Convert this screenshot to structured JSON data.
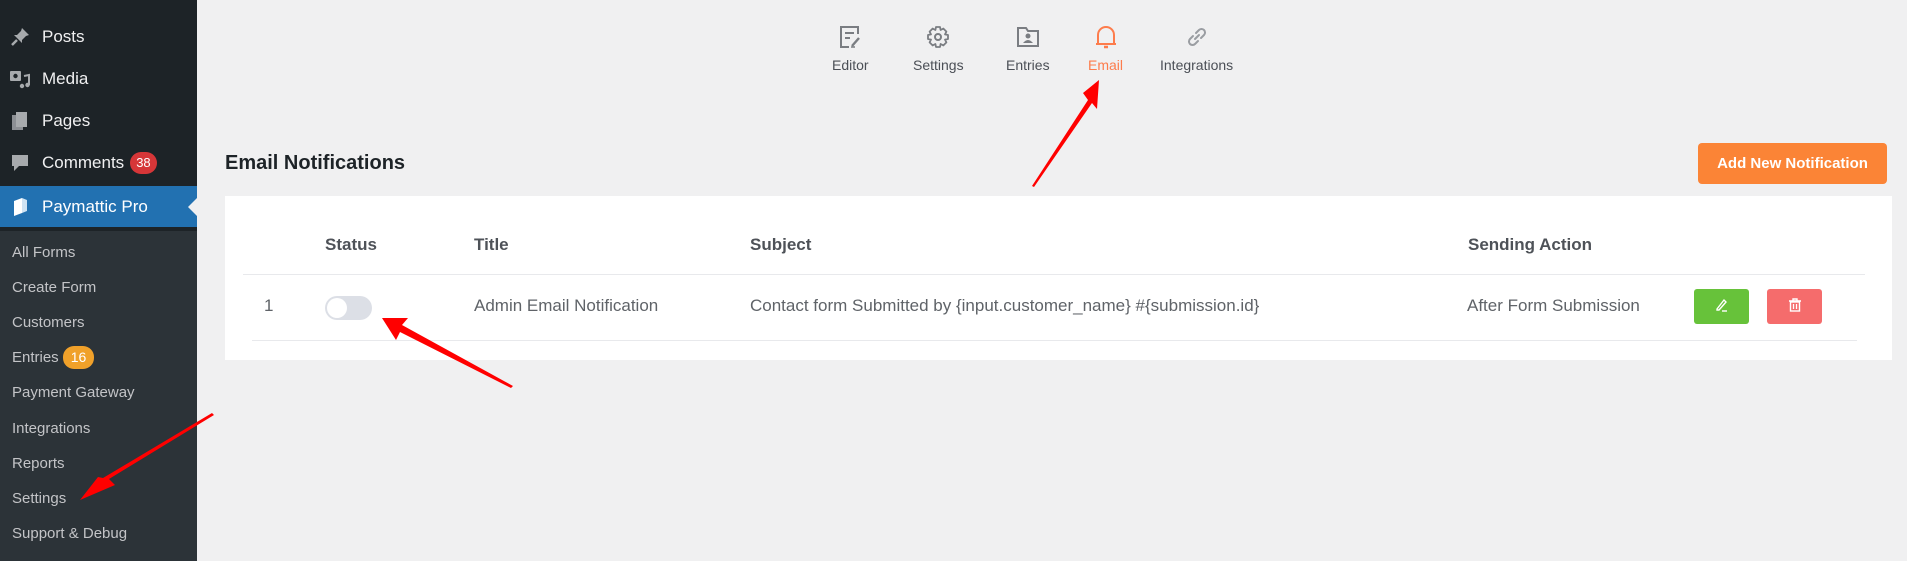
{
  "sidebar": {
    "items": [
      {
        "label": "Posts",
        "icon": "pin-icon"
      },
      {
        "label": "Media",
        "icon": "media-icon"
      },
      {
        "label": "Pages",
        "icon": "pages-icon"
      },
      {
        "label": "Comments",
        "icon": "comment-icon",
        "badge": "38"
      },
      {
        "label": "Paymattic Pro",
        "icon": "paymattic-icon",
        "active": true
      }
    ],
    "submenu": [
      {
        "label": "All Forms"
      },
      {
        "label": "Create Form"
      },
      {
        "label": "Customers"
      },
      {
        "label": "Entries",
        "badge": "16"
      },
      {
        "label": "Payment Gateway"
      },
      {
        "label": "Integrations"
      },
      {
        "label": "Reports"
      },
      {
        "label": "Settings"
      },
      {
        "label": "Support & Debug"
      }
    ]
  },
  "topnav": {
    "items": [
      {
        "label": "Editor",
        "icon": "editor-icon"
      },
      {
        "label": "Settings",
        "icon": "gear-icon"
      },
      {
        "label": "Entries",
        "icon": "entries-folder-icon"
      },
      {
        "label": "Email",
        "icon": "bell-icon",
        "active": true
      },
      {
        "label": "Integrations",
        "icon": "link-icon"
      }
    ],
    "active_color": "#fd7c4c"
  },
  "page": {
    "title": "Email Notifications",
    "add_button": "Add New Notification"
  },
  "table": {
    "columns": [
      "Status",
      "Title",
      "Subject",
      "Sending Action"
    ],
    "rows": [
      {
        "index": "1",
        "status_enabled": false,
        "title": "Admin Email Notification",
        "subject": "Contact form Submitted by {input.customer_name} #{submission.id}",
        "sending_action": "After Form Submission"
      }
    ]
  },
  "colors": {
    "accent_button": "#fb8436",
    "edit_button": "#67c23a",
    "delete_button": "#f56c6c",
    "sidebar_active": "#2271b1",
    "annotation_arrow": "#ff0000"
  }
}
